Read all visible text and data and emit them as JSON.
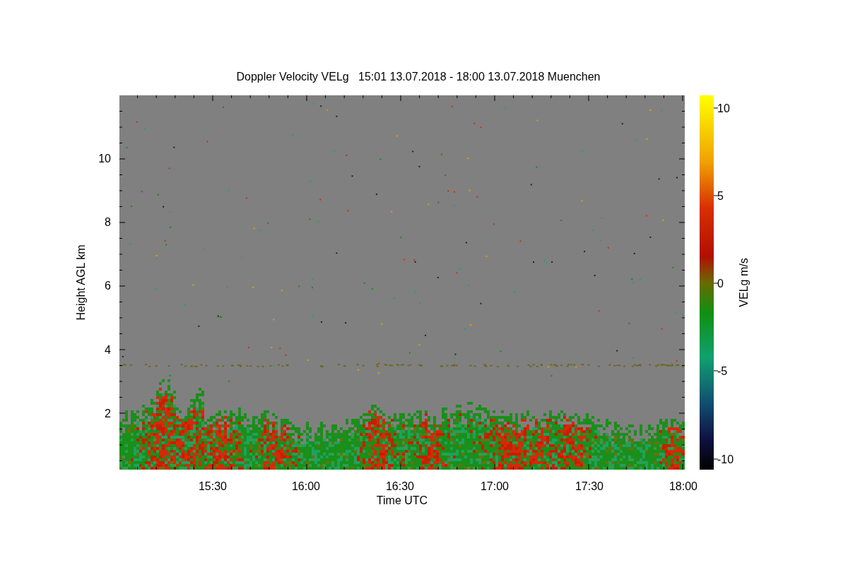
{
  "figure": {
    "title": "Doppler Velocity VELg   15:01 13.07.2018 - 18:00 13.07.2018 Muenchen",
    "xlabel": "Time UTC",
    "ylabel": "Height AGL km",
    "xticks": [
      "15:30",
      "16:00",
      "16:30",
      "17:00",
      "17:30",
      "18:00"
    ],
    "yticks": [
      "10",
      "8",
      "6",
      "4",
      "2"
    ],
    "colorbar": {
      "label": "VELg m/s",
      "ticks": [
        "10",
        "5",
        "0",
        "-5",
        "-10"
      ]
    }
  }
}
